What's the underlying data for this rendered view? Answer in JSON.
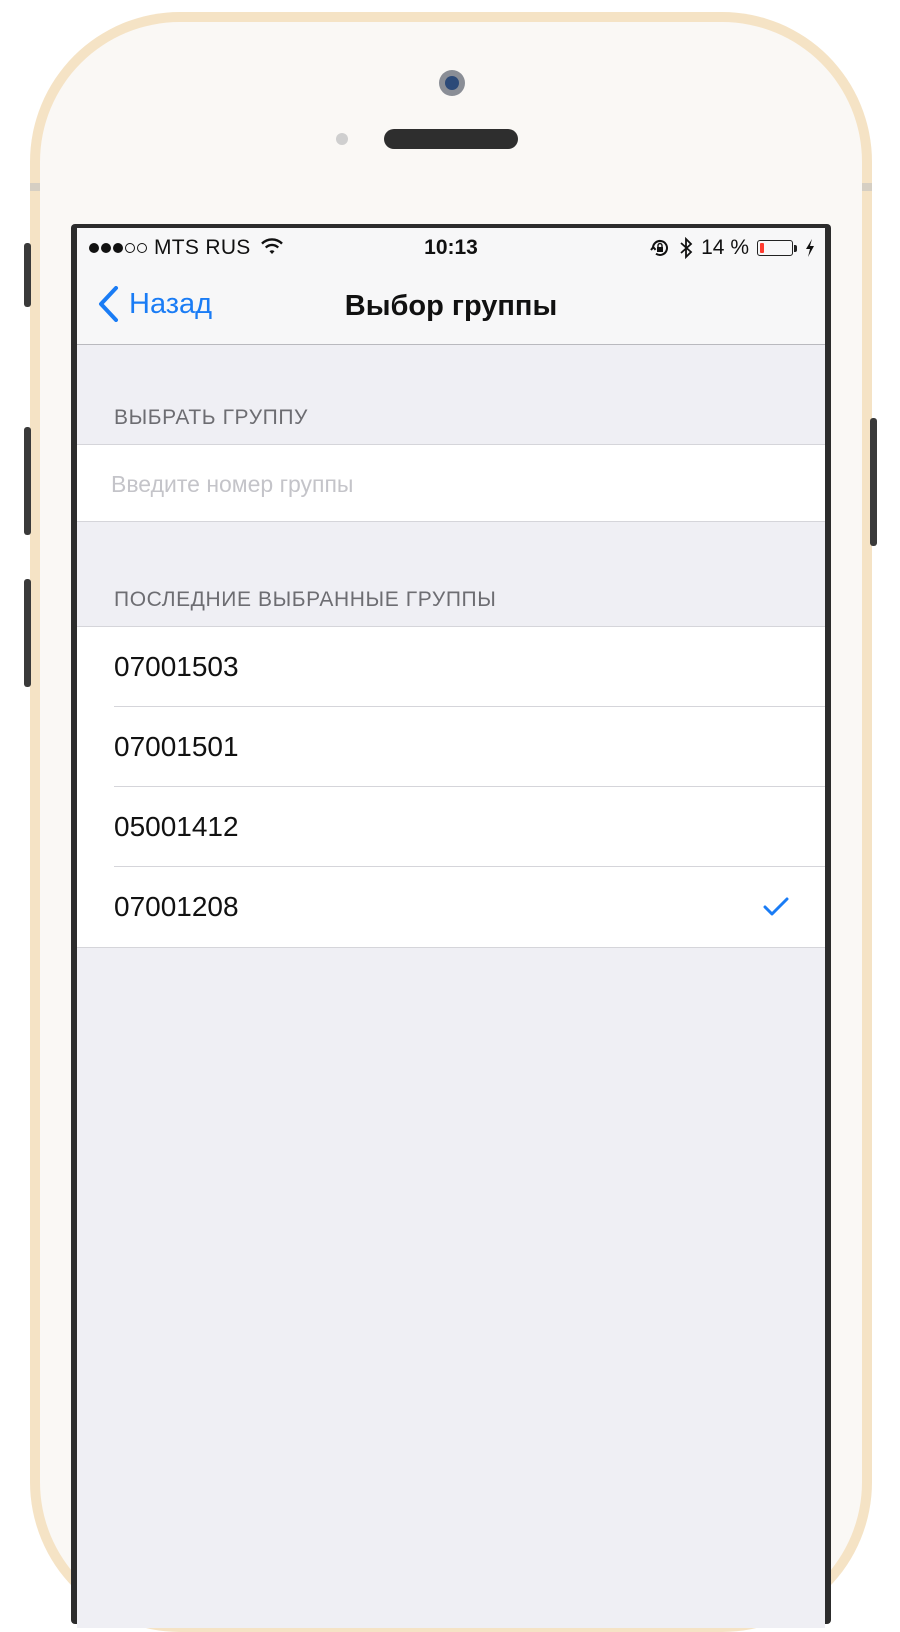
{
  "status_bar": {
    "signal_filled": 3,
    "signal_total": 5,
    "carrier": "MTS RUS",
    "time": "10:13",
    "battery_text": "14 %",
    "battery_level": 0.14
  },
  "nav": {
    "back_label": "Назад",
    "title": "Выбор группы"
  },
  "select_section": {
    "header": "ВЫБРАТЬ ГРУППУ",
    "input_value": "",
    "input_placeholder": "Введите номер группы"
  },
  "recent_section": {
    "header": "ПОСЛЕДНИЕ ВЫБРАННЫЕ ГРУППЫ",
    "groups": [
      {
        "label": "07001503",
        "selected": false
      },
      {
        "label": "07001501",
        "selected": false
      },
      {
        "label": "05001412",
        "selected": false
      },
      {
        "label": "07001208",
        "selected": true
      }
    ]
  },
  "colors": {
    "accent": "#1a7cf5",
    "battery_low": "#ff3b30",
    "background": "#efeff4",
    "phone_frame": "#f5e3c5"
  },
  "icons": [
    "wifi-icon",
    "orientation-lock-icon",
    "bluetooth-icon",
    "battery-icon",
    "charging-bolt-icon",
    "chevron-left-icon",
    "checkmark-icon"
  ]
}
